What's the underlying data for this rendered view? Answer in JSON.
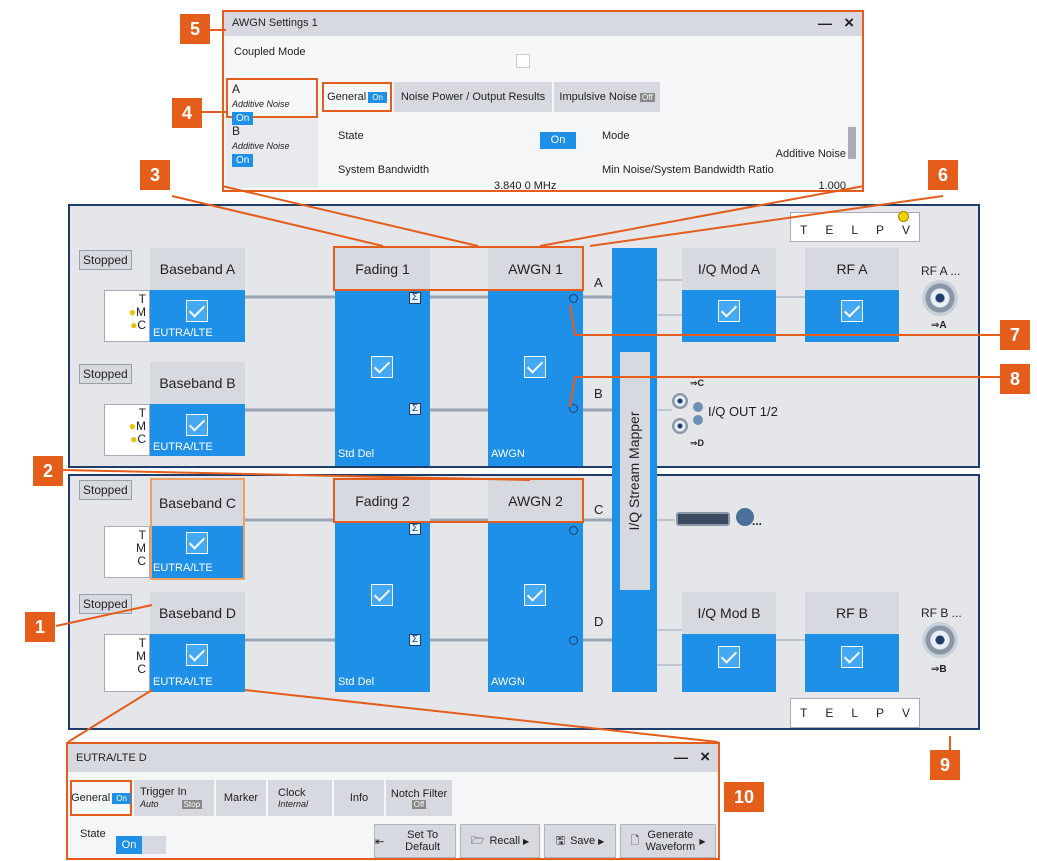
{
  "awgn_dialog": {
    "title": "AWGN Settings 1",
    "coupled_mode": "Coupled Mode",
    "minimize": "—",
    "close": "×",
    "paths": [
      {
        "name": "A",
        "sub": "Additive Noise",
        "state": "On"
      },
      {
        "name": "B",
        "sub": "Additive Noise",
        "state": "On"
      }
    ],
    "tabs": [
      {
        "label": "General",
        "badge": "On"
      },
      {
        "label": "Noise Power / Output Results"
      },
      {
        "label": "Impulsive Noise",
        "badge": "Off"
      }
    ],
    "state_label": "State",
    "state_value": "On",
    "mode_label": "Mode",
    "mode_value": "Additive Noise",
    "sysbw_label": "System Bandwidth",
    "sysbw_value": "3.840 0 MHz",
    "ratio_label": "Min Noise/System Bandwidth Ratio",
    "ratio_value": "1.000"
  },
  "diagram": {
    "stopped": "Stopped",
    "basebands": [
      {
        "title": "Baseband A",
        "std": "EUTRA/LTE",
        "t": "T",
        "m": "M",
        "c": "C"
      },
      {
        "title": "Baseband B",
        "std": "EUTRA/LTE",
        "t": "T",
        "m": "M",
        "c": "C"
      },
      {
        "title": "Baseband C",
        "std": "EUTRA/LTE",
        "t": "T",
        "m": "M",
        "c": "C"
      },
      {
        "title": "Baseband D",
        "std": "EUTRA/LTE",
        "t": "T",
        "m": "M",
        "c": "C"
      }
    ],
    "fading": [
      {
        "title": "Fading 1",
        "profile": "Std Del"
      },
      {
        "title": "Fading 2",
        "profile": "Std Del"
      }
    ],
    "awgn": [
      {
        "title": "AWGN 1",
        "mode": "AWGN"
      },
      {
        "title": "AWGN 2",
        "mode": "AWGN"
      }
    ],
    "path_letters": [
      "A",
      "B",
      "C",
      "D"
    ],
    "sigma": "Σ",
    "mapper": "I/Q Stream Mapper",
    "iqmod": [
      "I/Q Mod A",
      "I/Q Mod B"
    ],
    "rf": [
      "RF A",
      "RF B"
    ],
    "rf_out": [
      "RF A ...",
      "RF B ..."
    ],
    "rf_port": [
      "⇒A",
      "⇒B"
    ],
    "iq_out": "I/Q OUT 1/2",
    "iq_c": "⇒C",
    "iq_d": "⇒D",
    "dig_more": "...",
    "telpv": [
      "T",
      "E",
      "L",
      "P",
      "V"
    ]
  },
  "eutra_dialog": {
    "title": "EUTRA/LTE D",
    "minimize": "—",
    "close": "×",
    "tabs": [
      {
        "label": "General",
        "badge": "On"
      },
      {
        "label": "Trigger In",
        "sub": "Auto",
        "badge": "Stop"
      },
      {
        "label": "Marker"
      },
      {
        "label": "Clock",
        "sub": "Internal"
      },
      {
        "label": "Info"
      },
      {
        "label": "Notch Filter",
        "badge": "Off"
      }
    ],
    "state_label": "State",
    "state_value": "On",
    "buttons": [
      "Set To Default",
      "Recall",
      "Save",
      "Generate Waveform"
    ]
  },
  "callouts": [
    "1",
    "2",
    "3",
    "4",
    "5",
    "6",
    "7",
    "8",
    "9",
    "10"
  ],
  "colors": {
    "accent": "#e45d1a",
    "block": "#1e90e8",
    "frame": "#1f3d6b"
  }
}
